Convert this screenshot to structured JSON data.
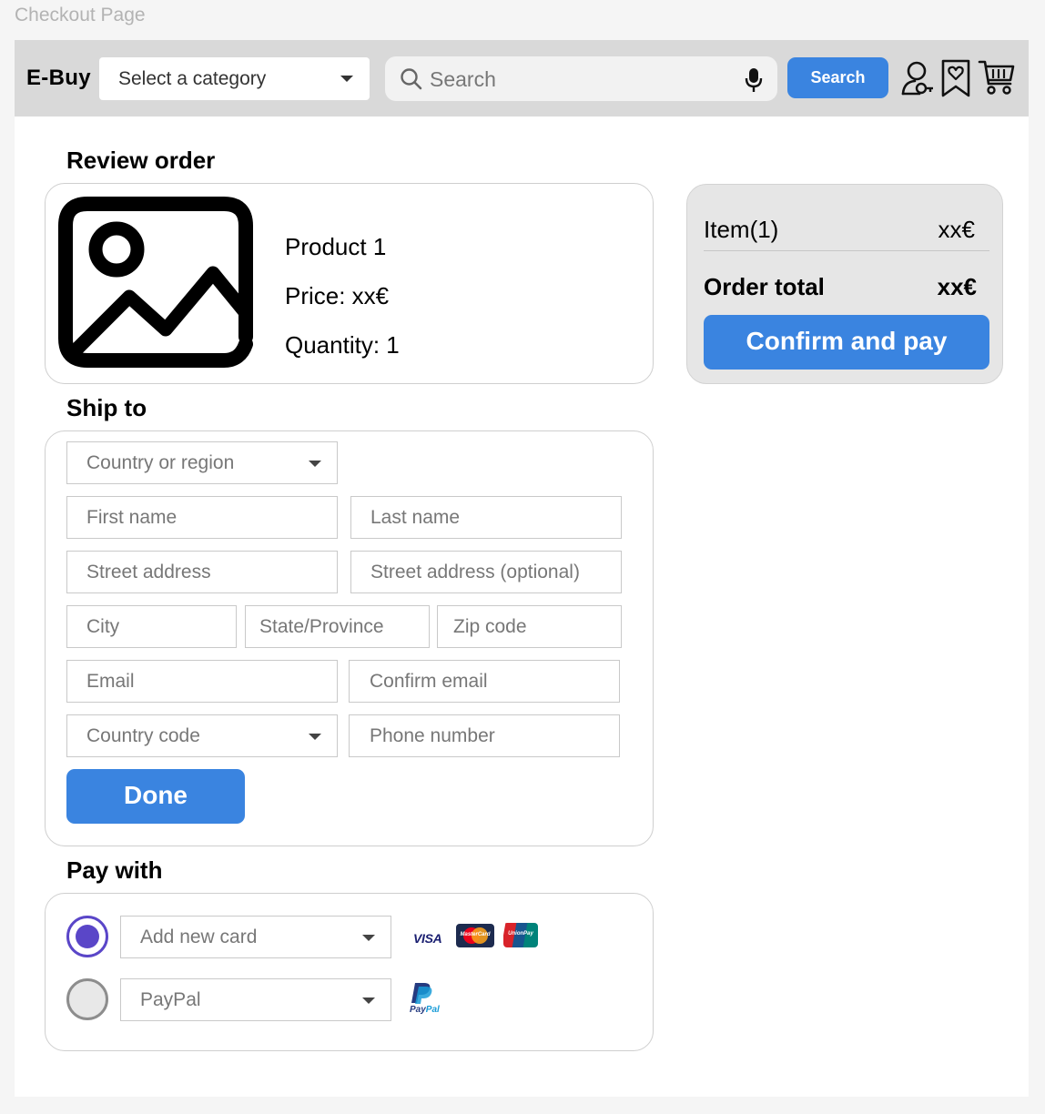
{
  "page_label": "Checkout Page",
  "header": {
    "brand": "E-Buy",
    "category_placeholder": "Select a category",
    "search_placeholder": "Search",
    "search_button": "Search"
  },
  "review": {
    "heading": "Review order",
    "product_name": "Product 1",
    "price": "Price: xx€",
    "quantity": "Quantity: 1"
  },
  "summary": {
    "item_label": "Item(1)",
    "item_value": "xx€",
    "total_label": "Order total",
    "total_value": "xx€",
    "confirm_button": "Confirm and pay"
  },
  "ship": {
    "heading": "Ship to",
    "country_region": "Country or region",
    "first_name": "First name",
    "last_name": "Last name",
    "street": "Street address",
    "street_optional": "Street address (optional)",
    "city": "City",
    "state": "State/Province",
    "zip": "Zip code",
    "email": "Email",
    "confirm_email": "Confirm email",
    "country_code": "Country code",
    "phone": "Phone number",
    "done_button": "Done"
  },
  "pay": {
    "heading": "Pay with",
    "card_option": "Add new card",
    "paypal_option": "PayPal",
    "visa_text": "VISA",
    "mastercard_text": "MasterCard",
    "unionpay_text": "UnionPay",
    "paypal_logo_a": "Pay",
    "paypal_logo_b": "Pal",
    "selected": "card",
    "accent_color": "#5a46c8"
  },
  "colors": {
    "primary_button": "#3a84e0",
    "header_bg": "#d9d9d9"
  }
}
